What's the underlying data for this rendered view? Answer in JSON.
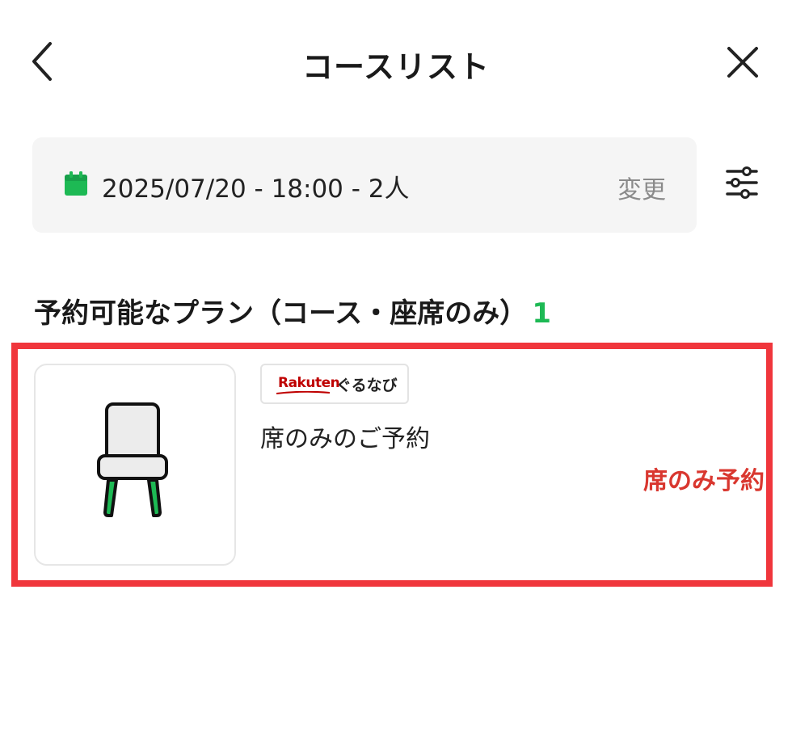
{
  "header": {
    "title": "コースリスト"
  },
  "search": {
    "date_text": "2025/07/20 - 18:00 - 2人",
    "change_label": "変更"
  },
  "section": {
    "title": "予約可能なプラン（コース・座席のみ）",
    "count": "1"
  },
  "plans": [
    {
      "badge": {
        "brand": "Rakuten",
        "service": "ぐるなび"
      },
      "name": "席のみのご予約",
      "action_label": "席のみ予約",
      "thumbnail_icon": "chair-icon"
    }
  ],
  "colors": {
    "accent_green": "#1db954",
    "highlight_red": "#f0363c",
    "action_red": "#d9372f",
    "rakuten_red": "#bf0000"
  },
  "icons": {
    "back": "chevron-left-icon",
    "close": "close-icon",
    "calendar": "calendar-icon",
    "filter": "sliders-icon"
  }
}
